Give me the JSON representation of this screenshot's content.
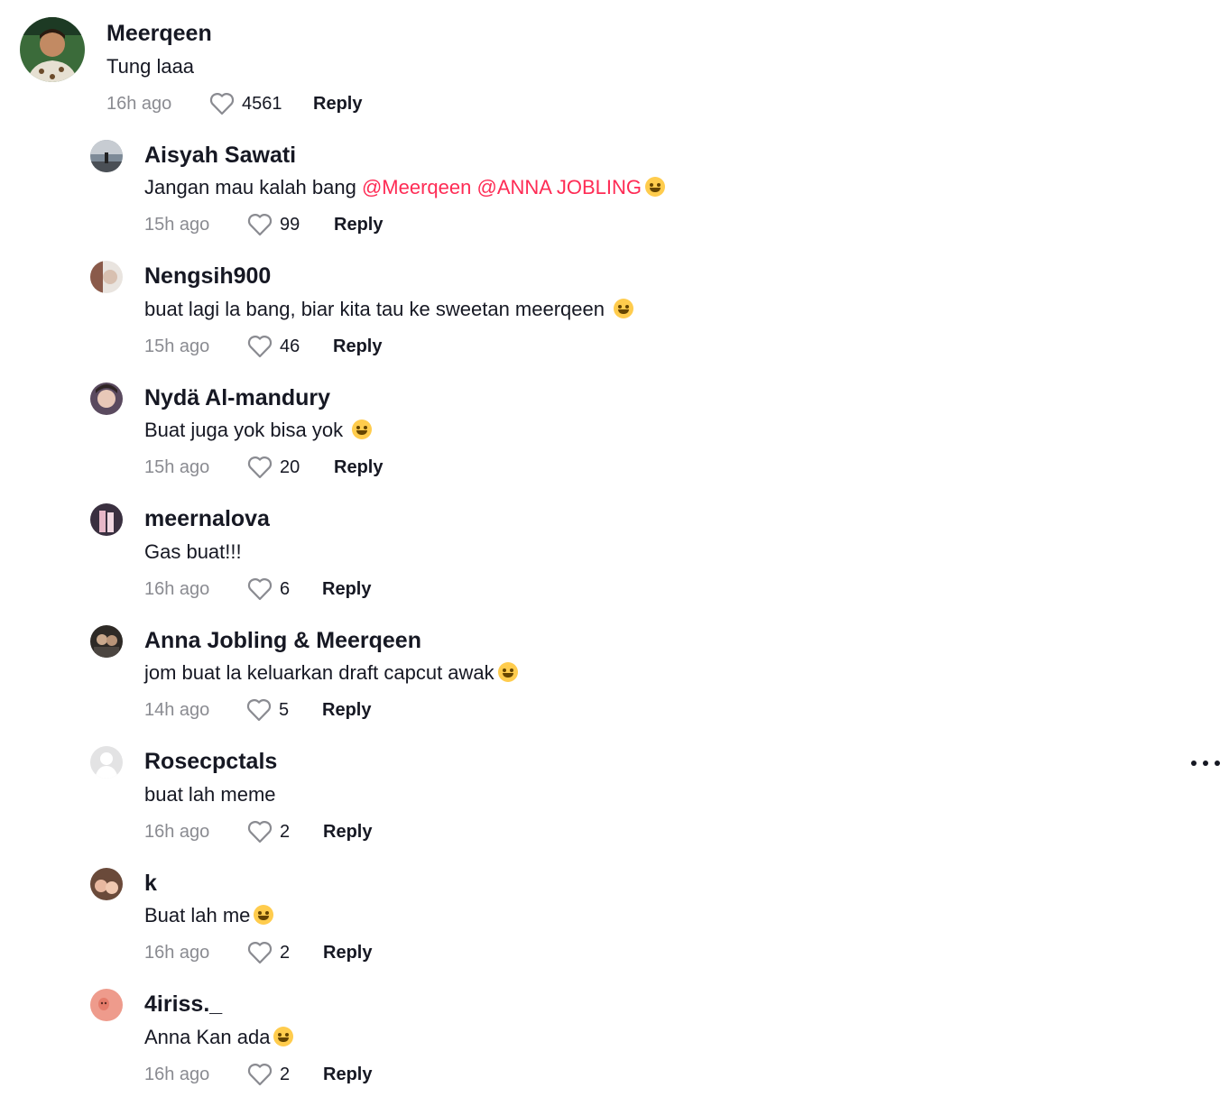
{
  "comment": {
    "user": "Meerqeen",
    "text": "Tung laaa",
    "time": "16h ago",
    "likes": "4561",
    "reply_label": "Reply",
    "avatar_icon": "user-avatar"
  },
  "replies": [
    {
      "user": "Aisyah Sawati",
      "text_prefix": "Jangan mau kalah bang ",
      "mentions": [
        "@Meerqeen",
        "@ANNA JOBLING"
      ],
      "emoji": "smiling-face-with-hearts",
      "time": "15h ago",
      "likes": "99",
      "reply_label": "Reply"
    },
    {
      "user": "Nengsih900",
      "text": "buat lagi la bang, biar kita tau ke sweetan meerqeen ",
      "emoji": "grinning-face",
      "time": "15h ago",
      "likes": "46",
      "reply_label": "Reply"
    },
    {
      "user": "Nydä Al-mandury",
      "text": "Buat juga yok bisa yok ",
      "emoji": "face-with-tears-of-joy",
      "time": "15h ago",
      "likes": "20",
      "reply_label": "Reply"
    },
    {
      "user": "meernalova",
      "text": "Gas buat!!!",
      "time": "16h ago",
      "likes": "6",
      "reply_label": "Reply"
    },
    {
      "user": "Anna Jobling & Meerqeen",
      "text": "jom buat la keluarkan draft capcut awak",
      "emoji": "rolling-on-the-floor-laughing",
      "time": "14h ago",
      "likes": "5",
      "reply_label": "Reply"
    },
    {
      "user": "Rosecpctals",
      "text": "buat lah meme",
      "time": "16h ago",
      "likes": "2",
      "reply_label": "Reply"
    },
    {
      "user": "k",
      "text": "Buat lah me",
      "emoji": "rolling-on-the-floor-laughing",
      "time": "16h ago",
      "likes": "2",
      "reply_label": "Reply"
    },
    {
      "user": "4iriss._",
      "text": "Anna Kan ada",
      "emoji": "relieved-face",
      "time": "16h ago",
      "likes": "2",
      "reply_label": "Reply"
    }
  ],
  "icons": {
    "like": "heart-outline-icon",
    "more": "more-options-icon"
  },
  "colors": {
    "text": "#161823",
    "muted": "#8a8b91",
    "mention": "#fe2c55"
  }
}
